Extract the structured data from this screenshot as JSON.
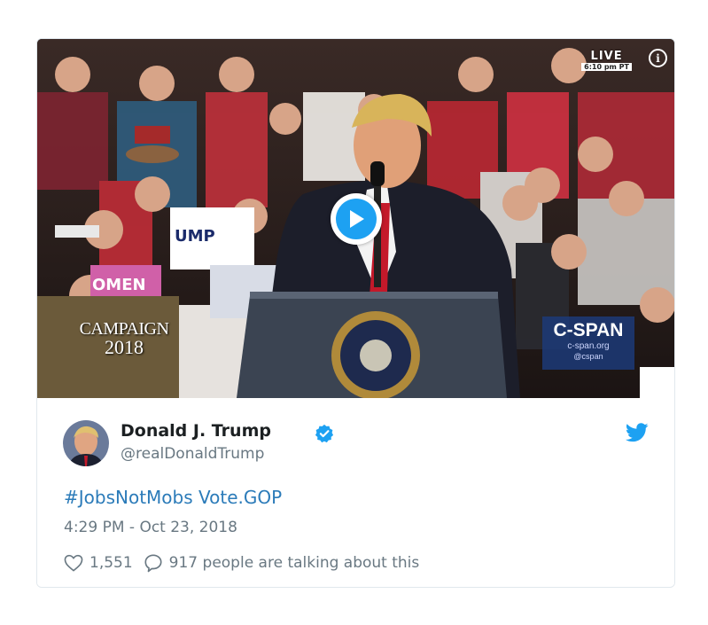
{
  "video": {
    "live_label": "LIVE",
    "live_time": "6:10 pm PT",
    "info_glyph": "i",
    "play_icon": "play-icon",
    "campaign_logo": {
      "word": "CAMPAIGN",
      "year": "2018"
    },
    "cspan_logo": {
      "word": "C-SPAN",
      "url": "c-span.org",
      "handle": "@cspan"
    }
  },
  "tweet": {
    "author": {
      "name": "Donald J. Trump",
      "handle": "@realDonaldTrump",
      "verified": true
    },
    "text": {
      "hashtag": "#JobsNotMobs",
      "link": "Vote.GOP"
    },
    "timestamp": "4:29 PM - Oct 23, 2018",
    "likes": "1,551",
    "conversation": "917 people are talking about this"
  },
  "colors": {
    "accent": "#1da1f2",
    "link": "#2b7bb9",
    "muted": "#697882",
    "border": "#e1e8ed"
  }
}
